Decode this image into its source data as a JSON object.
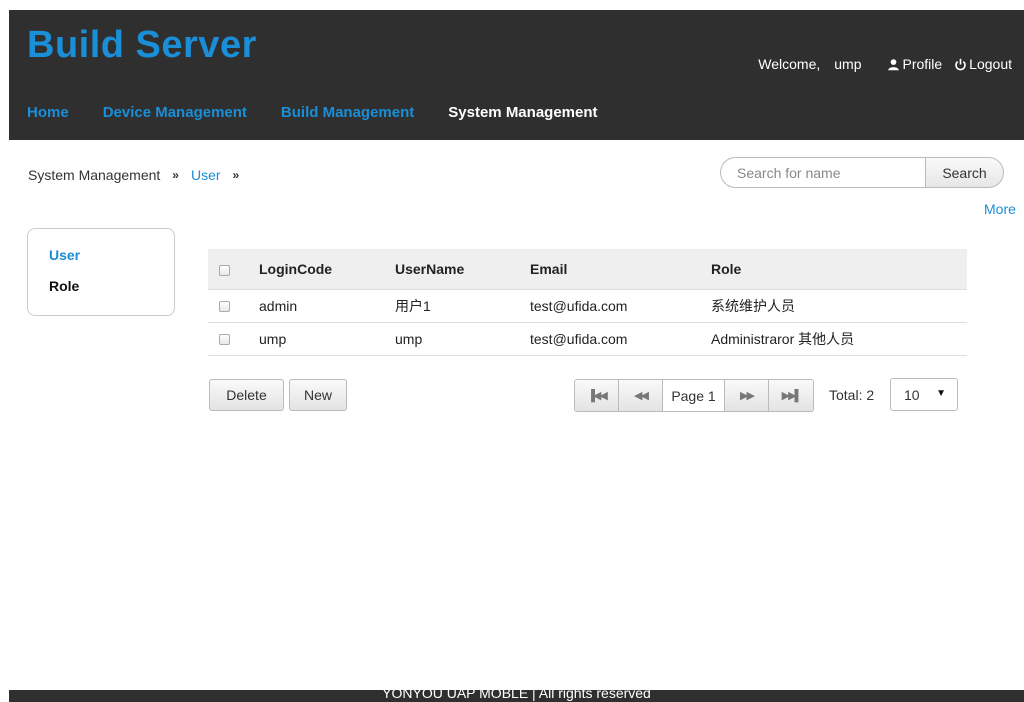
{
  "header": {
    "brand": "Build Server",
    "welcome": "Welcome,",
    "username": "ump",
    "profile": "Profile",
    "logout": "Logout"
  },
  "nav": [
    {
      "label": "Home",
      "active": false
    },
    {
      "label": "Device Management",
      "active": false
    },
    {
      "label": "Build Management",
      "active": false
    },
    {
      "label": "System Management",
      "active": true
    }
  ],
  "breadcrumb": {
    "root": "System Management",
    "sep": "»",
    "current": "User"
  },
  "search": {
    "placeholder": "Search for name",
    "button": "Search",
    "more": "More"
  },
  "sidebar": {
    "items": [
      {
        "label": "User",
        "active": true
      },
      {
        "label": "Role",
        "active": false
      }
    ]
  },
  "table": {
    "headers": [
      "LoginCode",
      "UserName",
      "Email",
      "Role"
    ],
    "rows": [
      [
        "admin",
        "用户1",
        "test@ufida.com",
        "系统维护人员"
      ],
      [
        "ump",
        "ump",
        "test@ufida.com",
        "Administraror 其他人员"
      ]
    ]
  },
  "actions": {
    "delete": "Delete",
    "new": "New"
  },
  "pager": {
    "page_label": "Page 1",
    "total": "Total: 2",
    "page_size": "10"
  },
  "footer": {
    "text": "YONYOU UAP MOBLE | All rights reserved"
  },
  "colors": {
    "accent": "#1a8ed6",
    "header_bg": "#2f2f2f"
  }
}
